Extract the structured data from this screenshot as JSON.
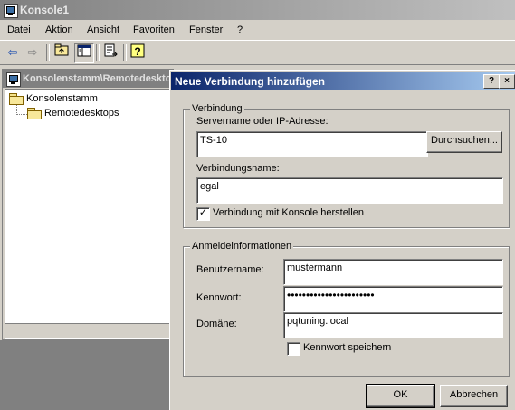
{
  "window": {
    "title": "Konsole1"
  },
  "menu": [
    "Datei",
    "Aktion",
    "Ansicht",
    "Favoriten",
    "Fenster",
    "?"
  ],
  "toolbar": {
    "icons": [
      "back-icon",
      "forward-icon",
      "up-folder-icon",
      "show-hide-tree-icon",
      "export-list-icon",
      "help-icon"
    ]
  },
  "inner_window": {
    "title": "Konsolenstamm\\Remotedesktops"
  },
  "tree": {
    "root": "Konsolenstamm",
    "child": "Remotedesktops"
  },
  "dialog": {
    "title": "Neue Verbindung hinzufügen",
    "help_button": "?",
    "close_button": "×",
    "connection_group": {
      "label": "Verbindung",
      "server_label": "Servername oder IP-Adresse:",
      "server_value": "TS-10",
      "browse_label": "Durchsuchen...",
      "name_label": "Verbindungsname:",
      "name_value": "egal",
      "console_checkbox_label": "Verbindung mit Konsole herstellen",
      "console_checked": true
    },
    "login_group": {
      "label": "Anmeldeinformationen",
      "user_label": "Benutzername:",
      "user_value": "mustermann",
      "password_label": "Kennwort:",
      "password_value": "•••••••••••••••••••••••",
      "domain_label": "Domäne:",
      "domain_value": "pqtuning.local",
      "save_password_label": "Kennwort speichern",
      "save_password_checked": false
    },
    "ok_label": "OK",
    "cancel_label": "Abbrechen"
  }
}
